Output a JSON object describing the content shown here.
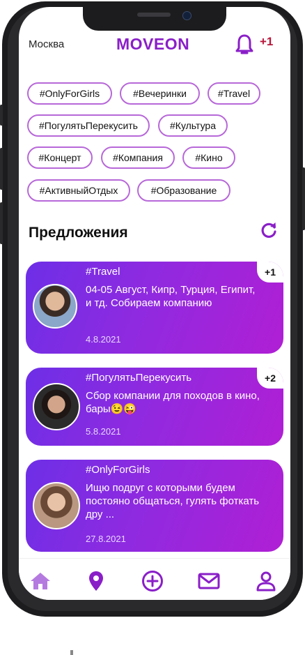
{
  "header": {
    "city": "Москва",
    "logo": "MOVEON",
    "notification_count": "+1"
  },
  "tags": [
    "#OnlyForGirls",
    "#Вечеринки",
    "#Travel",
    "#ПогулятьПерекусить",
    "#Культура",
    "#Концерт",
    "#Компания",
    "#Кино",
    "#АктивныйОтдых",
    "#Образование"
  ],
  "section": {
    "title": "Предложения"
  },
  "cards": [
    {
      "tag": "#Travel",
      "text": "04-05 Август, Кипр, Турция, Египит, и тд. Собираем компанию",
      "date": "4.8.2021",
      "badge": "+1"
    },
    {
      "tag": "#ПогулятьПерекусить",
      "text": "Сбор компании для походов в кино, бары😉😜",
      "date": "5.8.2021",
      "badge": "+2"
    },
    {
      "tag": "#OnlyForGirls",
      "text": "Ищю подруг с которыми будем постояно общаться, гулять фоткать дру ...",
      "date": "27.8.2021",
      "badge": ""
    }
  ],
  "tabbar": [
    "home-icon",
    "location-icon",
    "add-icon",
    "mail-icon",
    "profile-icon"
  ],
  "colors": {
    "accent": "#8a1fc8",
    "tag_border": "#b768d8",
    "card_start": "#6d2fe6",
    "card_end": "#b01fd4",
    "notification": "#b8163a"
  }
}
